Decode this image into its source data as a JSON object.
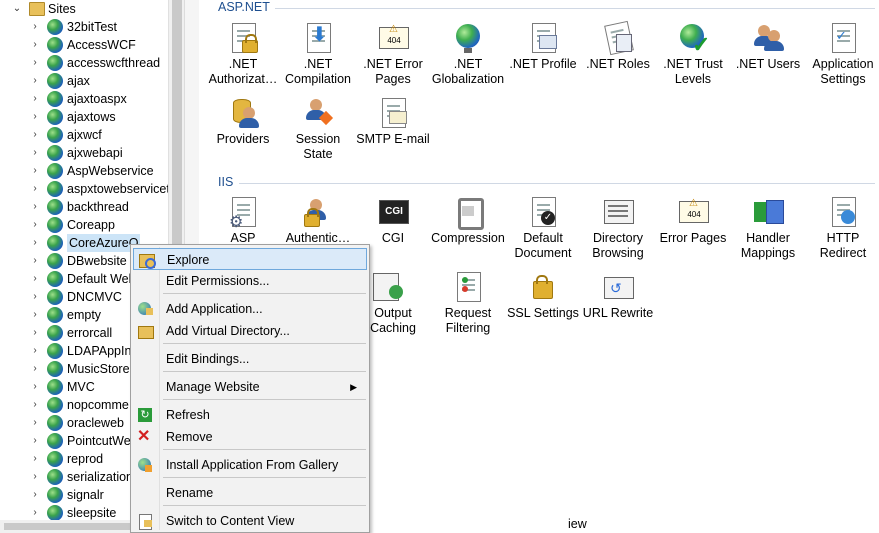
{
  "tree": {
    "root_label": "Sites",
    "sites": [
      "32bitTest",
      "AccessWCF",
      "accesswcfthread",
      "ajax",
      "ajaxtoaspx",
      "ajaxtows",
      "ajxwcf",
      "ajxwebapi",
      "AspWebservice",
      "aspxtowebservicet",
      "backthread",
      "Coreapp",
      "CoreAzureO",
      "DBwebsite",
      "Default Web",
      "DNCMVC",
      "empty",
      "errorcall",
      "LDAPAppIn",
      "MusicStore",
      "MVC",
      "nopcomme",
      "oracleweb",
      "PointcutWe",
      "reprod",
      "serialization",
      "signalr",
      "sleepsite"
    ],
    "selected_index": 12
  },
  "groups": {
    "aspnet": {
      "title": "ASP.NET",
      "features": [
        ".NET\nAuthorizat…",
        ".NET\nCompilation",
        ".NET Error\nPages",
        ".NET\nGlobalization",
        ".NET Profile",
        ".NET Roles",
        ".NET Trust\nLevels",
        ".NET Users",
        "Application\nSettings",
        "Providers",
        "Session State",
        "SMTP E-mail"
      ]
    },
    "iis": {
      "title": "IIS",
      "features": [
        "ASP",
        "Authentic…",
        "CGI",
        "Compression",
        "Default\nDocument",
        "Directory\nBrowsing",
        "Error Pages",
        "Handler\nMappings",
        "HTTP\nRedirect",
        "",
        "",
        "Output\nCaching",
        "Request\nFiltering",
        "SSL Settings",
        "URL Rewrite"
      ]
    }
  },
  "icon_texts": {
    "error_code": "404",
    "cgi": "CGI"
  },
  "bottom_text": "iew",
  "context_menu": {
    "items": [
      {
        "label": "Explore",
        "icon": "explore-icon",
        "highlighted": true
      },
      {
        "label": "Edit Permissions...",
        "icon": ""
      },
      {
        "label": "Add Application...",
        "icon": "add-application-icon"
      },
      {
        "label": "Add Virtual Directory...",
        "icon": "add-virtual-directory-icon"
      },
      {
        "label": "Edit Bindings...",
        "icon": ""
      },
      {
        "label": "Manage Website",
        "icon": "",
        "submenu": true
      },
      {
        "label": "Refresh",
        "icon": "refresh-icon"
      },
      {
        "label": "Remove",
        "icon": "remove-icon"
      },
      {
        "label": "Install Application From Gallery",
        "icon": "gallery-icon"
      },
      {
        "label": "Rename",
        "icon": ""
      },
      {
        "label": "Switch to Content View",
        "icon": "content-view-icon"
      }
    ]
  },
  "colors": {
    "accent": "#1e4f8f",
    "highlight": "#dbeaf9",
    "selection": "#cce4f7"
  }
}
